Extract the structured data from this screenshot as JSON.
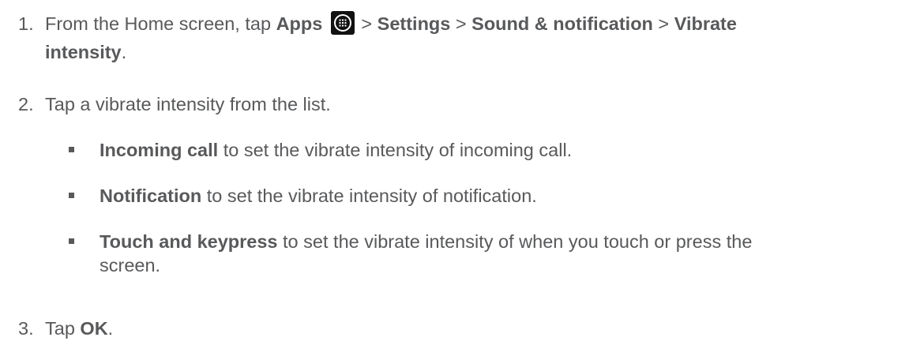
{
  "steps": [
    {
      "number": "1.",
      "pre": "From the Home screen, tap ",
      "apps": "Apps",
      "sep1": " > ",
      "settings": "Settings",
      "sep2": " > ",
      "sound": "Sound & notification",
      "sep3": " > ",
      "vibrate": "Vibrate",
      "intensity": "intensity",
      "end": "."
    },
    {
      "number": "2.",
      "text": "Tap a vibrate intensity from the list."
    },
    {
      "number": "3.",
      "pre": "Tap ",
      "ok": "OK",
      "end": "."
    }
  ],
  "bullets": [
    {
      "bold": "Incoming call",
      "text": " to set the vibrate intensity of incoming call."
    },
    {
      "bold": "Notification",
      "text": " to set the vibrate intensity of notification."
    },
    {
      "bold": "Touch and keypress",
      "text_line1": " to set the vibrate intensity of when you touch or press the",
      "text_line2": "screen."
    }
  ],
  "icons": {
    "apps": "apps-grid-icon"
  }
}
